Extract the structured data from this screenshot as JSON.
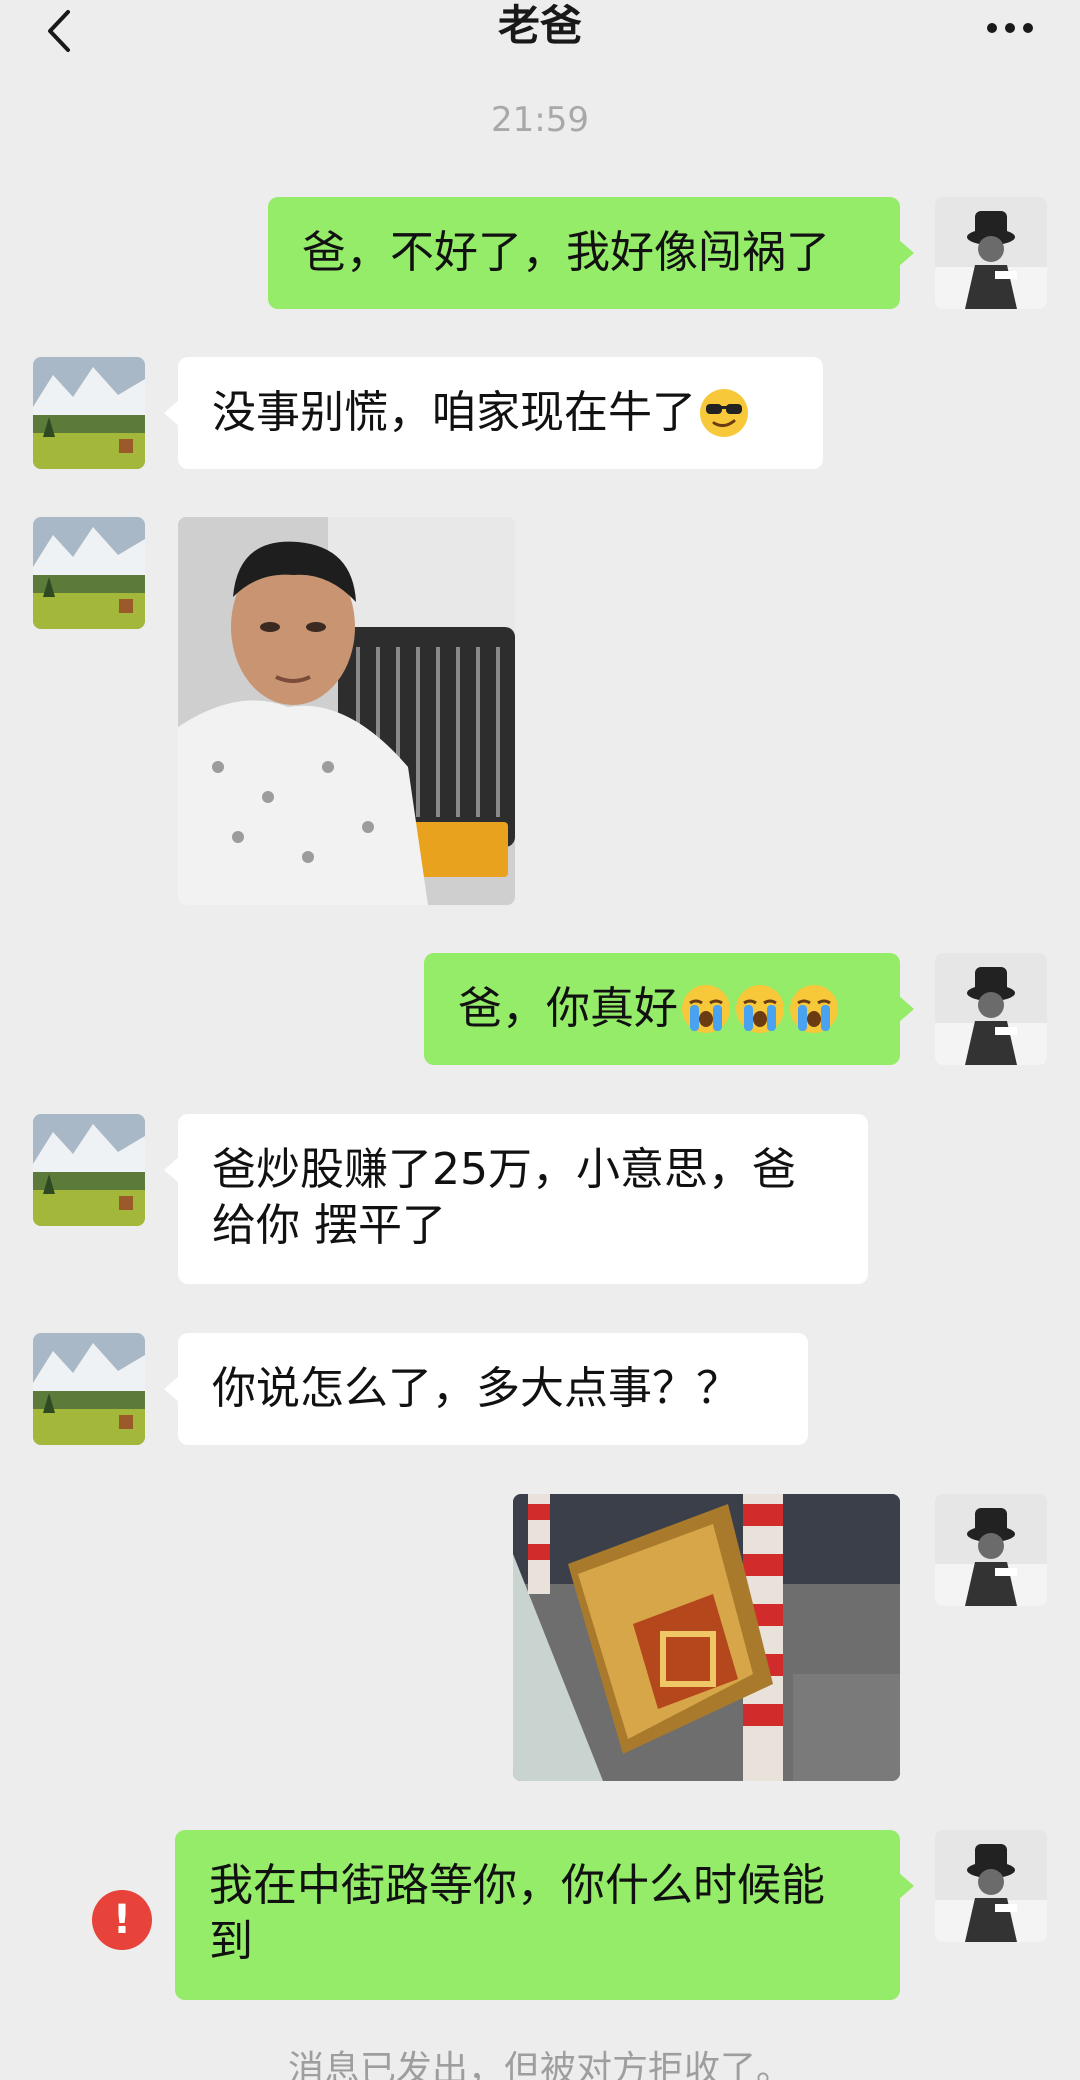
{
  "header": {
    "title": "老爸",
    "back_icon": "chevron-left-icon",
    "more_icon": "more-dots-icon"
  },
  "timestamp": "21:59",
  "messages": [
    {
      "side": "right",
      "type": "text",
      "text": "爸，不好了，我好像闯祸了"
    },
    {
      "side": "left",
      "type": "text",
      "text": "没事别慌，咱家现在牛了",
      "emoji": "sunglasses-emoji"
    },
    {
      "side": "left",
      "type": "image",
      "description_icon": "photo-man-with-car"
    },
    {
      "side": "right",
      "type": "text",
      "text": "爸，你真好",
      "emoji": "crying-emoji"
    },
    {
      "side": "left",
      "type": "text",
      "lines": [
        "爸炒股赚了25万，小意思，爸",
        "给你 摆平了"
      ]
    },
    {
      "side": "left",
      "type": "text",
      "text": "你说怎么了，多大点事？？"
    },
    {
      "side": "right",
      "type": "image",
      "description_icon": "photo-gold-brick"
    },
    {
      "side": "right",
      "type": "text",
      "lines": [
        "我在中街路等你，你什么时候能",
        "到"
      ],
      "status": "failed"
    }
  ],
  "error_badge": "!",
  "system_note": "消息已发出，但被对方拒收了。",
  "colors": {
    "background": "#ededed",
    "green_bubble": "#95ec69",
    "white_bubble": "#ffffff",
    "error": "#e8433b"
  }
}
